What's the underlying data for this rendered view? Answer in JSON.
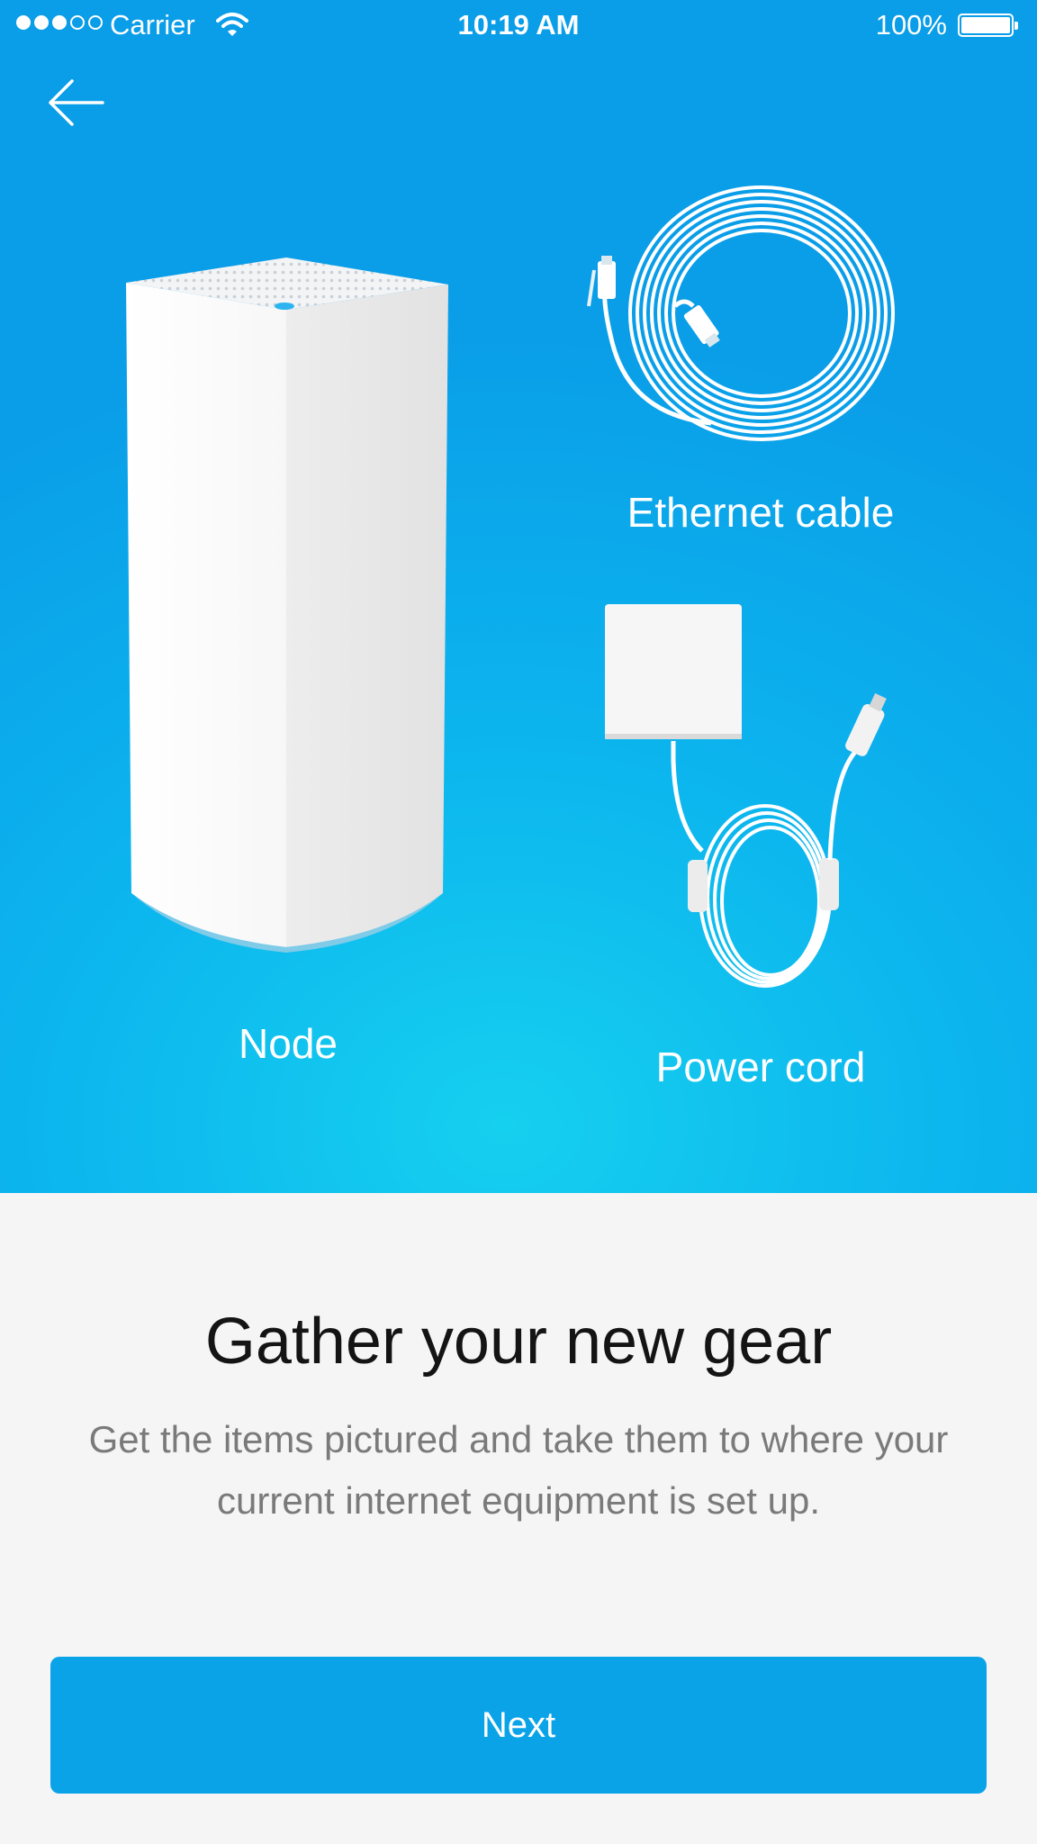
{
  "status_bar": {
    "carrier": "Carrier",
    "time": "10:19 AM",
    "battery": "100%"
  },
  "nav": {
    "back_icon": "arrow-left-icon"
  },
  "items": {
    "node": "Node",
    "ethernet": "Ethernet cable",
    "power": "Power cord"
  },
  "content": {
    "headline": "Gather your new gear",
    "body": "Get the items pictured and take them to where your current internet equipment is set up."
  },
  "actions": {
    "next_label": "Next"
  },
  "colors": {
    "hero_top": "#0a9de8",
    "hero_glow": "#16d0ef",
    "button": "#0ba3e8",
    "background": "#f5f5f5"
  }
}
